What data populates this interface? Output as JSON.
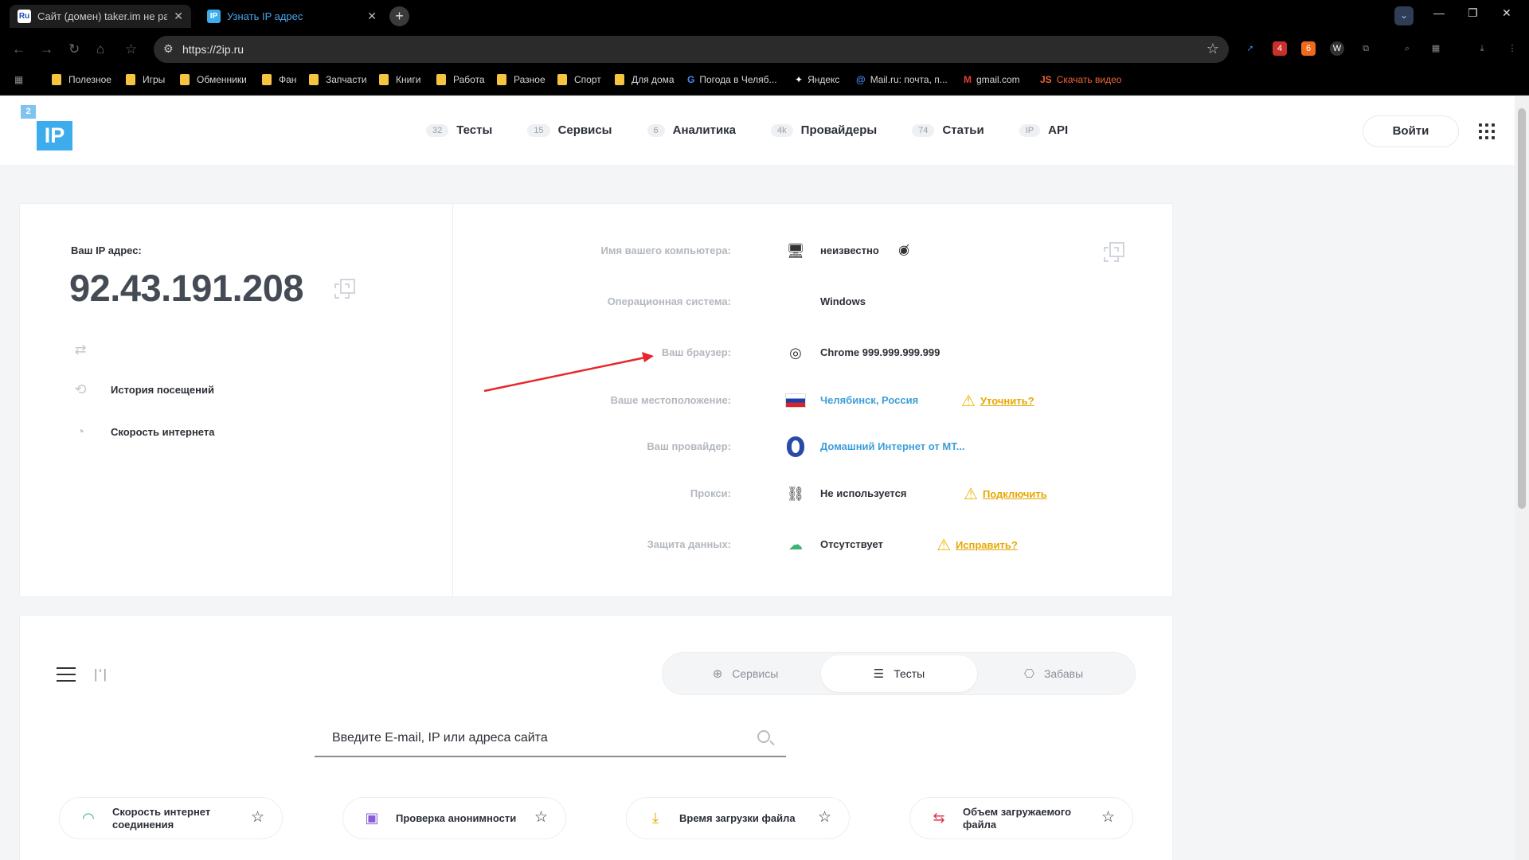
{
  "browser": {
    "tabs": [
      {
        "favicon": "Ru",
        "title": "Сайт (домен) taker.im не работает"
      },
      {
        "favicon": "IP",
        "title": "Узнать IP адрес"
      }
    ],
    "new_tab": "+",
    "url": "https://2ip.ru",
    "extension_badges": [
      "4",
      "6"
    ],
    "bookmarks": [
      {
        "label": "Полезное",
        "icon": "folder-icon"
      },
      {
        "label": "Игры",
        "icon": "folder-icon"
      },
      {
        "label": "Обменники",
        "icon": "folder-icon"
      },
      {
        "label": "Фан",
        "icon": "folder-icon"
      },
      {
        "label": "Запчасти",
        "icon": "folder-icon"
      },
      {
        "label": "Книги",
        "icon": "folder-icon"
      },
      {
        "label": "Работа",
        "icon": "folder-icon"
      },
      {
        "label": "Разное",
        "icon": "folder-icon"
      },
      {
        "label": "Спорт",
        "icon": "folder-icon"
      },
      {
        "label": "Для дома",
        "icon": "folder-icon"
      },
      {
        "label": "Погода в Челяб...",
        "icon": "google-icon"
      },
      {
        "label": "Яндекс",
        "icon": "yandex-icon"
      },
      {
        "label": "Mail.ru: почта, п...",
        "icon": "mailru-icon"
      },
      {
        "label": "gmail.com",
        "icon": "gmail-icon"
      },
      {
        "label": "Скачать видео",
        "icon": "js-icon"
      }
    ],
    "colors": {
      "tab_active_text": "#4aa3e8",
      "folder": "#f5c542"
    }
  },
  "site": {
    "logo": {
      "sup": "2",
      "main": "IP"
    },
    "nav": [
      {
        "count": "32",
        "label": "Тесты"
      },
      {
        "count": "15",
        "label": "Сервисы"
      },
      {
        "count": "6",
        "label": "Аналитика"
      },
      {
        "count": "4k",
        "label": "Провайдеры"
      },
      {
        "count": "74",
        "label": "Статьи"
      },
      {
        "count": "IP",
        "label": "API"
      }
    ],
    "login": "Войти"
  },
  "ip_card": {
    "caption": "Ваш IP адрес:",
    "ip": "92.43.191.208",
    "links": [
      {
        "label": "История посещений",
        "icon": "history-icon"
      },
      {
        "label": "Скорость интернета",
        "icon": "speed-icon"
      }
    ],
    "rows": [
      {
        "label": "Имя вашего компьютера:",
        "value": "неизвестно",
        "icon": "monitor-icon"
      },
      {
        "label": "Операционная система:",
        "value": "Windows",
        "icon": "windows-icon"
      },
      {
        "label": "Ваш браузер:",
        "value": "Chrome 999.999.999.999",
        "icon": "chrome-icon"
      },
      {
        "label": "Ваше местоположение:",
        "value": "Челябинск, Россия",
        "icon": "russia-flag-icon",
        "action": "Уточнить?"
      },
      {
        "label": "Ваш провайдер:",
        "value": "Домашний Интернет от МТ...",
        "icon": "isp-logo-icon"
      },
      {
        "label": "Прокси:",
        "value": "Не используется",
        "icon": "proxy-icon",
        "action": "Подключить"
      },
      {
        "label": "Защита данных:",
        "value": "Отсутствует",
        "icon": "cloud-lock-icon",
        "action": "Исправить?"
      }
    ],
    "colors": {
      "link": "#3c9fd8",
      "warning": "#f0b400",
      "annotation_arrow": "#e8262b"
    }
  },
  "tools": {
    "segments": [
      {
        "label": "Сервисы",
        "icon": "globe-icon",
        "active": false
      },
      {
        "label": "Тесты",
        "icon": "sliders-icon",
        "active": true
      },
      {
        "label": "Забавы",
        "icon": "gamepad-icon",
        "active": false
      }
    ],
    "search_placeholder": "Введите E-mail, IP или адреса сайта",
    "items": [
      {
        "label": "Скорость интернет соединения",
        "icon": "speedometer-icon"
      },
      {
        "label": "Проверка анонимности",
        "icon": "anonymity-icon"
      },
      {
        "label": "Время загрузки файла",
        "icon": "download-time-icon"
      },
      {
        "label": "Объем загружаемого файла",
        "icon": "file-size-icon"
      }
    ]
  }
}
